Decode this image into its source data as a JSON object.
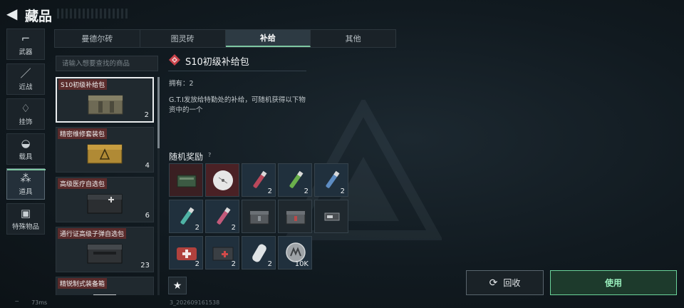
{
  "header": {
    "title": "藏品"
  },
  "sidebar": {
    "items": [
      {
        "label": "武器",
        "icon": "pistol-icon"
      },
      {
        "label": "近战",
        "icon": "knife-icon"
      },
      {
        "label": "挂饰",
        "icon": "charm-icon"
      },
      {
        "label": "载具",
        "icon": "car-icon"
      },
      {
        "label": "道具",
        "icon": "items-icon",
        "active": true
      },
      {
        "label": "特殊物品",
        "icon": "toolbox-icon"
      }
    ]
  },
  "tabs": [
    {
      "label": "曼德尔砖"
    },
    {
      "label": "图灵砖"
    },
    {
      "label": "补给",
      "active": true
    },
    {
      "label": "其他"
    }
  ],
  "search": {
    "placeholder": "请输入想要查找的商品"
  },
  "list": {
    "items": [
      {
        "label": "S10初级补给包",
        "count": "2",
        "selected": true
      },
      {
        "label": "精密维修套装包",
        "count": "4"
      },
      {
        "label": "高级医疗自选包",
        "count": "6"
      },
      {
        "label": "通行证高级子弹自选包",
        "count": "23"
      },
      {
        "label": "精锐制式装备箱",
        "count": ""
      }
    ]
  },
  "detail": {
    "title": "S10初级补给包",
    "owned": "拥有：2",
    "description": "G.T.I发放给特勤处的补给，可随机获得以下物资中的一个",
    "rewards_title": "随机奖励",
    "rewards_help": "?",
    "rewards": [
      {
        "icon": "ammo-box-icon",
        "count": ""
      },
      {
        "icon": "disc-icon",
        "count": ""
      },
      {
        "icon": "red-syringe-icon",
        "count": "2"
      },
      {
        "icon": "green-syringe-icon",
        "count": "2"
      },
      {
        "icon": "blue-syringe-icon",
        "count": "2"
      },
      {
        "icon": "teal-syringe-icon",
        "count": "2"
      },
      {
        "icon": "pink-syringe-icon",
        "count": "2"
      },
      {
        "icon": "gray-case-icon",
        "count": ""
      },
      {
        "icon": "red-case-icon",
        "count": ""
      },
      {
        "icon": "battery-icon",
        "count": ""
      },
      {
        "icon": "medkit-icon",
        "count": "2"
      },
      {
        "icon": "first-aid-pouch-icon",
        "count": "2"
      },
      {
        "icon": "bandage-icon",
        "count": "2"
      },
      {
        "icon": "coin-icon",
        "count": "10K"
      }
    ]
  },
  "actions": {
    "recycle_label": "回收",
    "use_label": "使用"
  },
  "status": {
    "ping": "73ms",
    "version": "3_202609161538"
  }
}
